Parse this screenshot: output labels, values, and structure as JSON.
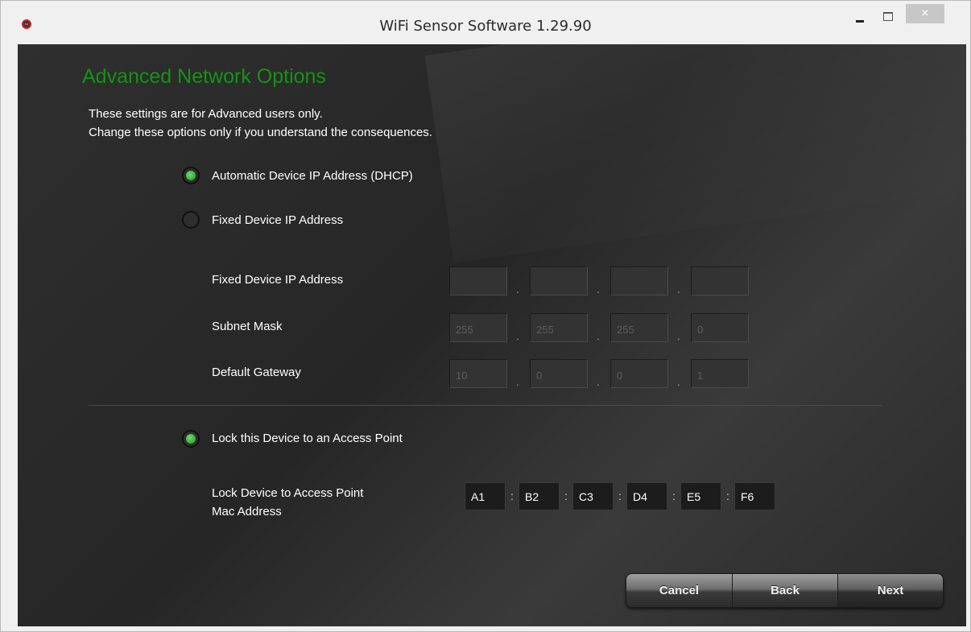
{
  "window": {
    "title": "WiFi Sensor Software 1.29.90",
    "controls": {
      "minimize": "minimize",
      "maximize": "maximize",
      "close": "×"
    },
    "icon": "app-logo-icon"
  },
  "page": {
    "heading": "Advanced Network Options",
    "desc_line1": "These settings are for Advanced users only.",
    "desc_line2": "Change these options only if you understand the consequences."
  },
  "ip_mode": {
    "dhcp_label": "Automatic Device IP Address (DHCP)",
    "dhcp_selected": true,
    "fixed_label": "Fixed Device IP Address",
    "fixed_selected": false
  },
  "fixed_fields": {
    "ip_label": "Fixed Device IP Address",
    "ip_octets": [
      "",
      "",
      "",
      ""
    ],
    "subnet_label": "Subnet Mask",
    "subnet_octets": [
      "255",
      "255",
      "255",
      "0"
    ],
    "gateway_label": "Default Gateway",
    "gateway_octets": [
      "10",
      "0",
      "0",
      "1"
    ],
    "separator": "."
  },
  "lock": {
    "label": "Lock this Device to an Access Point",
    "selected": true,
    "mac_label_line1": "Lock Device to Access Point",
    "mac_label_line2": "Mac Address",
    "mac_octets": [
      "A1",
      "B2",
      "C3",
      "D4",
      "E5",
      "F6"
    ],
    "separator": ":"
  },
  "buttons": {
    "cancel": "Cancel",
    "back": "Back",
    "next": "Next"
  },
  "colors": {
    "heading_green": "#1a8f1a",
    "radio_green": "#3fbf3f",
    "background": "#2b2b2b"
  }
}
